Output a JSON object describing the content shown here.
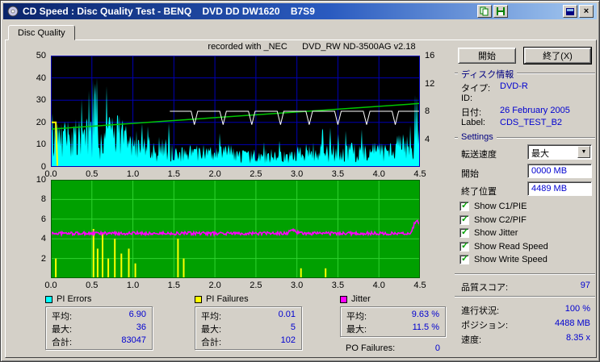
{
  "window": {
    "title": "CD Speed : Disc Quality Test - BENQ    DVD DD DW1620    B7S9"
  },
  "icons": {
    "close": "×",
    "combo_arrow": "▼",
    "checkmark": "✓"
  },
  "tabs": [
    {
      "label": "Disc Quality"
    }
  ],
  "chart": {
    "annotation": "recorded with _NEC      DVD_RW ND-3500AG v2.18"
  },
  "chart_data": [
    {
      "type": "area",
      "title": "PI Errors / Speed",
      "bg": "#000000",
      "grid": "#0000b4",
      "border": "#0000b4",
      "x_range": [
        0,
        4.5
      ],
      "x_ticks": [
        "0.0",
        "0.5",
        "1.0",
        "1.5",
        "2.0",
        "2.5",
        "3.0",
        "3.5",
        "4.0",
        "4.5"
      ],
      "y_left": {
        "ticks": [
          0,
          10,
          20,
          30,
          40,
          50
        ],
        "max": 50
      },
      "y_right": {
        "ticks": [
          4,
          8,
          12,
          16
        ],
        "max": 16
      },
      "series": [
        {
          "name": "PI Errors",
          "color": "#00ffff",
          "style": "noise-area",
          "avg": 6.9,
          "max": 36,
          "total": 83047,
          "segments": [
            [
              0,
              0.1,
              12,
              8
            ],
            [
              0.1,
              0.5,
              13,
              9
            ],
            [
              0.5,
              0.63,
              20,
              20
            ],
            [
              0.63,
              0.92,
              14,
              10
            ],
            [
              0.92,
              1.5,
              8,
              6
            ],
            [
              1.5,
              2.2,
              6,
              4
            ],
            [
              2.2,
              3.0,
              5,
              3.5
            ],
            [
              3.0,
              4.2,
              6.5,
              4.5
            ],
            [
              4.2,
              4.44,
              9,
              6
            ],
            [
              4.44,
              4.51,
              22,
              12
            ]
          ]
        },
        {
          "name": "Write Speed",
          "color": "#00c800",
          "style": "line",
          "points": [
            [
              0,
              17
            ],
            [
              4.5,
              28.5
            ]
          ]
        },
        {
          "name": "Read Speed",
          "color": "#ffffff",
          "style": "notch-line",
          "base": 25,
          "start": 1.45,
          "end": 4.5,
          "notch_xs": [
            1.75,
            2.1,
            2.45,
            2.8,
            3.15,
            3.5,
            3.85,
            4.2
          ],
          "notch_depth": 6,
          "notch_halfwidth": 0.04
        },
        {
          "name": "Start Marker",
          "color": "#ffff00",
          "style": "line",
          "points": [
            [
              0.0,
              20
            ],
            [
              0.06,
              20
            ],
            [
              0.08,
              0.5
            ]
          ]
        }
      ]
    },
    {
      "type": "line",
      "title": "Jitter / PI Failures",
      "bg": "#00a000",
      "grid": "#2fd32f",
      "border": "#006000",
      "x_range": [
        0,
        4.5
      ],
      "x_ticks": [
        "0.0",
        "0.5",
        "1.0",
        "1.5",
        "2.0",
        "2.5",
        "3.0",
        "3.5",
        "4.0",
        "4.5"
      ],
      "y_left": {
        "ticks": [
          2,
          4,
          6,
          8,
          10
        ],
        "max": 10
      },
      "series": [
        {
          "name": "Jitter",
          "color": "#ff00ff",
          "style": "noise-line",
          "base": 4.55,
          "amp": 0.16,
          "bumps": [
            [
              2.95,
              0.35
            ],
            [
              4.46,
              1.3
            ]
          ],
          "avg_pct": "9.63 %",
          "max_pct": "11.5 %"
        },
        {
          "name": "PI Failures",
          "color": "#ffff00",
          "style": "spikes",
          "max": 5,
          "total": 102,
          "spikes": [
            [
              0.06,
              2
            ],
            [
              0.52,
              5
            ],
            [
              0.57,
              3
            ],
            [
              0.63,
              4.5
            ],
            [
              0.7,
              2
            ],
            [
              0.78,
              4
            ],
            [
              0.86,
              2.5
            ],
            [
              0.95,
              3
            ],
            [
              1.03,
              1.5
            ],
            [
              1.55,
              4
            ],
            [
              1.62,
              2
            ],
            [
              3.05,
              1
            ],
            [
              3.35,
              1
            ]
          ]
        }
      ]
    }
  ],
  "legend": {
    "boxes": [
      {
        "title": "PI Errors",
        "color": "#00ffff",
        "rows": [
          {
            "label": "平均:",
            "value": "6.90"
          },
          {
            "label": "最大:",
            "value": "36"
          },
          {
            "label": "合計:",
            "value": "83047"
          }
        ]
      },
      {
        "title": "PI Failures",
        "color": "#ffff00",
        "rows": [
          {
            "label": "平均:",
            "value": "0.01"
          },
          {
            "label": "最大:",
            "value": "5"
          },
          {
            "label": "合計:",
            "value": "102"
          }
        ]
      },
      {
        "title": "Jitter",
        "color": "#ff00ff",
        "rows": [
          {
            "label": "平均:",
            "value": "9.63 %"
          },
          {
            "label": "最大:",
            "value": "11.5 %"
          }
        ]
      }
    ],
    "po_failures": {
      "label": "PO Failures:",
      "value": "0"
    }
  },
  "panel": {
    "start_button": "開始",
    "exit_button": "終了(X)",
    "disc_info": {
      "title": "ディスク情報",
      "rows": [
        {
          "label": "タイプ:",
          "value": "DVD-R"
        },
        {
          "label": "ID:",
          "value": ""
        },
        {
          "label": "日付:",
          "value": "26 February 2005"
        },
        {
          "label": "Label:",
          "value": "CDS_TEST_B2"
        }
      ]
    },
    "settings": {
      "title": "Settings",
      "speed_label": "転送速度",
      "speed_value": "最大",
      "start_label": "開始",
      "start_value": "0000 MB",
      "end_label": "終了位置",
      "end_value": "4489 MB",
      "checkboxes": [
        {
          "label": "Show C1/PIE",
          "checked": true
        },
        {
          "label": "Show C2/PIF",
          "checked": true
        },
        {
          "label": "Show Jitter",
          "checked": true
        },
        {
          "label": "Show Read Speed",
          "checked": true
        },
        {
          "label": "Show Write Speed",
          "checked": true
        }
      ]
    },
    "quality": {
      "label": "品質スコア:",
      "value": "97"
    },
    "progress": [
      {
        "label": "進行状況:",
        "value": "100 %"
      },
      {
        "label": "ポジション:",
        "value": "4488 MB"
      },
      {
        "label": "速度:",
        "value": "8.35 x"
      }
    ]
  }
}
